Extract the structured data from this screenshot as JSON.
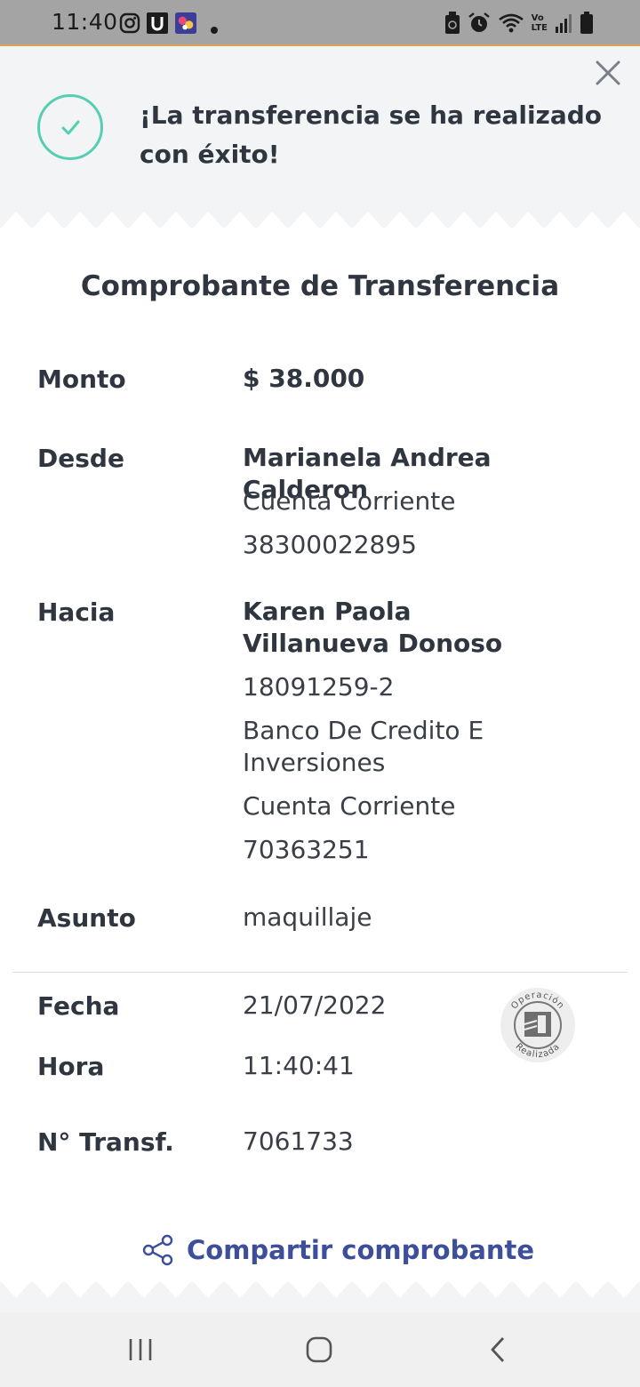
{
  "status_bar": {
    "time": "11:40",
    "left_icons": [
      "instagram-icon",
      "u-app-icon",
      "game-app-icon",
      "notification-dot-icon"
    ],
    "right_icons": [
      "battery-saver-icon",
      "alarm-icon",
      "wifi-icon",
      "volte-icon",
      "signal-icon",
      "battery-icon"
    ],
    "volte_top": "Vo",
    "volte_bottom": "LTE"
  },
  "header": {
    "success_message": "¡La transferencia se ha realizado con éxito!",
    "success_icon": "check-circle-icon",
    "accent_color": "#55cfb0"
  },
  "receipt": {
    "title": "Comprobante de Transferencia",
    "monto": {
      "label": "Monto",
      "value": "$ 38.000"
    },
    "desde": {
      "label": "Desde",
      "name": "Marianela Andrea Calderon",
      "account_type": "Cuenta Corriente",
      "account_number": "38300022895"
    },
    "hacia": {
      "label": "Hacia",
      "name": "Karen Paola Villanueva Donoso",
      "rut": "18091259-2",
      "bank": "Banco De Credito E Inversiones",
      "account_type": "Cuenta Corriente",
      "account_number": "70363251"
    },
    "asunto": {
      "label": "Asunto",
      "value": "maquillaje"
    },
    "fecha": {
      "label": "Fecha",
      "value": "21/07/2022"
    },
    "hora": {
      "label": "Hora",
      "value": "11:40:41"
    },
    "transf": {
      "label": "N° Transf.",
      "value": "7061733"
    },
    "stamp": {
      "top_text": "Operación",
      "bottom_text": "Realizada"
    }
  },
  "share": {
    "label": "Compartir comprobante",
    "color": "#3d4f9a"
  },
  "nav_bar": {
    "buttons": [
      "recent-apps-icon",
      "home-icon",
      "back-icon"
    ]
  }
}
